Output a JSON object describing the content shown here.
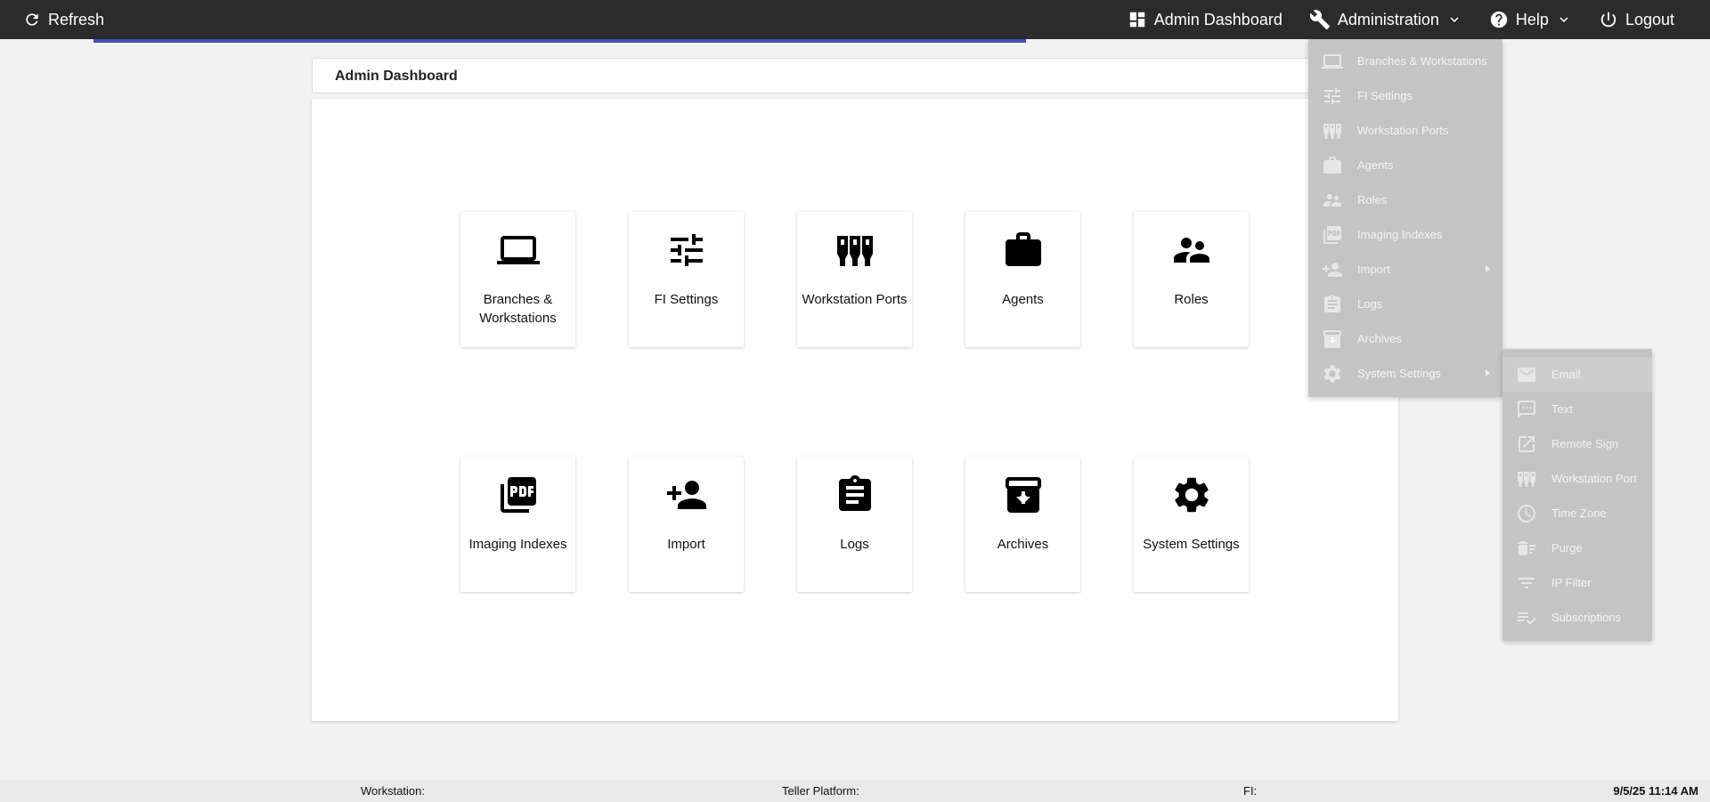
{
  "topbar": {
    "refresh_label": "Refresh",
    "admin_dashboard_label": "Admin Dashboard",
    "administration_label": "Administration",
    "help_label": "Help",
    "logout_label": "Logout"
  },
  "page": {
    "title": "Admin Dashboard"
  },
  "tiles": [
    {
      "label": "Branches & Workstations",
      "icon": "laptop-icon"
    },
    {
      "label": "FI Settings",
      "icon": "tune-icon"
    },
    {
      "label": "Workstation Ports",
      "icon": "ports-icon"
    },
    {
      "label": "Agents",
      "icon": "briefcase-icon"
    },
    {
      "label": "Roles",
      "icon": "people-icon"
    },
    {
      "label": "Imaging Indexes",
      "icon": "pdf-icon"
    },
    {
      "label": "Import",
      "icon": "person-add-icon"
    },
    {
      "label": "Logs",
      "icon": "clipboard-icon"
    },
    {
      "label": "Archives",
      "icon": "archive-icon"
    },
    {
      "label": "System Settings",
      "icon": "gear-icon"
    }
  ],
  "admin_menu": [
    {
      "label": "Branches & Workstations",
      "icon": "laptop-icon"
    },
    {
      "label": "FI Settings",
      "icon": "tune-icon"
    },
    {
      "label": "Workstation Ports",
      "icon": "ports-icon"
    },
    {
      "label": "Agents",
      "icon": "briefcase-icon"
    },
    {
      "label": "Roles",
      "icon": "people-icon"
    },
    {
      "label": "Imaging Indexes",
      "icon": "pdf-icon"
    },
    {
      "label": "Import",
      "icon": "person-add-icon",
      "has_submenu": true
    },
    {
      "label": "Logs",
      "icon": "clipboard-icon"
    },
    {
      "label": "Archives",
      "icon": "archive-icon"
    },
    {
      "label": "System Settings",
      "icon": "gear-icon",
      "has_submenu": true
    }
  ],
  "system_settings_menu": [
    {
      "label": "Email",
      "icon": "mail-icon"
    },
    {
      "label": "Text",
      "icon": "sms-icon"
    },
    {
      "label": "Remote Sign",
      "icon": "open-in-new-icon"
    },
    {
      "label": "Workstation Port",
      "icon": "ports-icon"
    },
    {
      "label": "Time Zone",
      "icon": "clock-icon"
    },
    {
      "label": "Purge",
      "icon": "delete-sweep-icon"
    },
    {
      "label": "IP Filter",
      "icon": "filter-icon"
    },
    {
      "label": "Subscriptions",
      "icon": "playlist-check-icon"
    }
  ],
  "footer": {
    "workstation_label": "Workstation:",
    "teller_platform_label": "Teller Platform:",
    "fi_label": "FI:",
    "datetime": "9/5/25 11:14 AM"
  },
  "colors": {
    "topbar": "#2b2b2b",
    "progress": "#3f51b5",
    "menu_bg": "#c4c4c4"
  }
}
